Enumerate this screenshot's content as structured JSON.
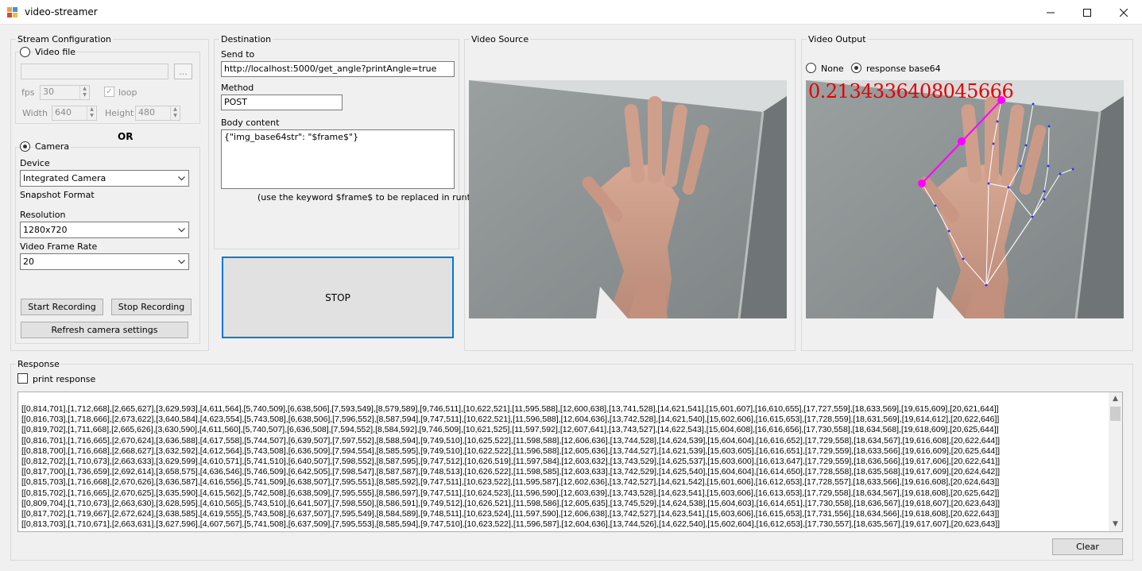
{
  "window": {
    "title": "video-streamer",
    "minimize": "🗕",
    "maximize": "☐",
    "close": "✕"
  },
  "stream_config": {
    "group_label": "Stream Configuration",
    "video_file_label": "Video file",
    "video_file_path": "",
    "browse_label": "...",
    "fps_label": "fps",
    "fps_value": "30",
    "loop_label": "loop",
    "loop_checked": true,
    "width_label": "Width",
    "width_value": "640",
    "height_label": "Height",
    "height_value": "480",
    "or_label": "OR",
    "camera_label": "Camera",
    "device_label": "Device",
    "device_value": "Integrated Camera",
    "snapshot_label": "Snapshot Format",
    "resolution_label": "Resolution",
    "resolution_value": "1280x720",
    "framerate_label": "Video Frame Rate",
    "framerate_value": "20",
    "start_recording": "Start Recording",
    "stop_recording": "Stop Recording",
    "refresh_camera": "Refresh camera settings"
  },
  "destination": {
    "group_label": "Destination",
    "send_to_label": "Send to",
    "send_to_value": "http://localhost:5000/get_angle?printAngle=true",
    "method_label": "Method",
    "method_value": "POST",
    "body_label": "Body content",
    "body_value": "{\"img_base64str\": \"$frame$\"}",
    "body_hint": "(use the keyword $frame$ to be replaced in runtime)",
    "stop_button": "STOP"
  },
  "video_source": {
    "group_label": "Video Source"
  },
  "video_output": {
    "group_label": "Video Output",
    "none_label": "None",
    "response_label": "response base64",
    "angle_overlay": "0.2134336408045666",
    "overlay_color": "#e60000",
    "line_color": "#ff00ff"
  },
  "response": {
    "group_label": "Response",
    "print_label": "print response",
    "clear_label": "Clear",
    "lines": [
      "[[0,814,701],[1,712,668],[2,665,627],[3,629,593],[4,611,564],[5,740,509],[6,638,506],[7,593,549],[8,579,589],[9,746,511],[10,622,521],[11,595,588],[12,600,638],[13,741,528],[14,621,541],[15,601,607],[16,610,655],[17,727,559],[18,633,569],[19,615,609],[20,621,644]]",
      "[[0,816,703],[1,718,666],[2,673,622],[3,640,584],[4,623,554],[5,743,508],[6,638,506],[7,596,552],[8,587,594],[9,747,511],[10,622,521],[11,596,588],[12,604,636],[13,742,528],[14,621,540],[15,602,606],[16,615,653],[17,728,559],[18,631,569],[19,614,612],[20,622,646]]",
      "[[0,819,702],[1,711,668],[2,665,626],[3,630,590],[4,611,560],[5,740,507],[6,636,508],[7,594,552],[8,584,592],[9,746,509],[10,621,525],[11,597,592],[12,607,641],[13,743,527],[14,622,543],[15,604,608],[16,616,656],[17,730,558],[18,634,568],[19,618,609],[20,625,644]]",
      "[[0,816,701],[1,716,665],[2,670,624],[3,636,588],[4,617,558],[5,744,507],[6,639,507],[7,597,552],[8,588,594],[9,749,510],[10,625,522],[11,598,588],[12,606,636],[13,744,528],[14,624,539],[15,604,604],[16,616,652],[17,729,558],[18,634,567],[19,616,608],[20,622,644]]",
      "[[0,818,700],[1,716,668],[2,668,627],[3,632,592],[4,612,564],[5,743,508],[6,636,509],[7,594,554],[8,585,595],[9,749,510],[10,622,522],[11,596,588],[12,605,636],[13,744,527],[14,621,539],[15,603,605],[16,616,651],[17,729,559],[18,633,566],[19,616,609],[20,625,644]]",
      "[[0,812,702],[1,710,673],[2,663,633],[3,629,599],[4,610,571],[5,741,510],[6,640,507],[7,598,552],[8,587,595],[9,747,512],[10,626,519],[11,597,584],[12,603,632],[13,743,529],[14,625,537],[15,603,600],[16,613,647],[17,729,559],[18,636,566],[19,617,606],[20,622,641]]",
      "[[0,817,700],[1,736,659],[2,692,614],[3,658,575],[4,636,546],[5,746,509],[6,642,505],[7,598,547],[8,587,587],[9,748,513],[10,626,522],[11,598,585],[12,603,633],[13,742,529],[14,625,540],[15,604,604],[16,614,650],[17,728,558],[18,635,568],[19,617,609],[20,624,642]]",
      "[[0,815,703],[1,716,668],[2,670,626],[3,636,587],[4,616,556],[5,741,509],[6,638,507],[7,595,551],[8,585,592],[9,747,511],[10,623,522],[11,595,587],[12,602,636],[13,742,527],[14,621,542],[15,601,606],[16,612,653],[17,728,557],[18,633,566],[19,616,608],[20,624,643]]",
      "[[0,815,702],[1,716,665],[2,670,625],[3,635,590],[4,615,562],[5,742,508],[6,638,509],[7,595,555],[8,586,597],[9,747,511],[10,624,523],[11,596,590],[12,603,639],[13,743,528],[14,623,541],[15,603,606],[16,613,653],[17,729,558],[18,634,567],[19,618,608],[20,625,642]]",
      "[[0,809,704],[1,710,673],[2,663,630],[3,628,595],[4,610,565],[5,743,510],[6,641,507],[7,598,550],[8,586,591],[9,749,512],[10,626,521],[11,598,586],[12,605,635],[13,745,529],[14,624,538],[15,604,603],[16,614,651],[17,730,558],[18,636,567],[19,618,607],[20,623,643]]",
      "[[0,817,702],[1,719,667],[2,672,624],[3,638,585],[4,619,555],[5,743,508],[6,637,507],[7,595,549],[8,584,589],[9,748,511],[10,623,524],[11,597,590],[12,606,638],[13,742,527],[14,623,541],[15,603,606],[16,615,653],[17,731,556],[18,634,566],[19,618,608],[20,622,643]]",
      "[[0,813,703],[1,710,671],[2,663,631],[3,627,596],[4,607,567],[5,741,508],[6,637,509],[7,595,553],[8,585,594],[9,747,510],[10,623,522],[11,596,587],[12,604,636],[13,744,526],[14,622,540],[15,602,604],[16,612,653],[17,730,557],[18,635,567],[19,617,607],[20,623,643]]"
    ]
  }
}
